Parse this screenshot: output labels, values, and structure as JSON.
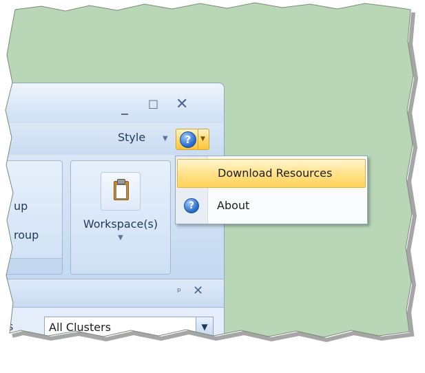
{
  "window_controls": {
    "minimize": "_",
    "maximize": "□",
    "close": "✕"
  },
  "menubar": {
    "style_label": "Style",
    "style_arrow": "▼",
    "help_glyph": "?",
    "help_arrow": "▼"
  },
  "ribbon": {
    "left_group": {
      "line1": "up",
      "line2": "roup"
    },
    "workspace_group": {
      "label": "Workspace(s)",
      "arrow": "▼",
      "icon": "clipboard-icon"
    }
  },
  "panel": {
    "pin_glyph": "ᵖ",
    "close_glyph": "✕",
    "filter_label": "s",
    "cluster_select": {
      "value": "All Clusters",
      "arrow": "▼"
    }
  },
  "help_menu": {
    "items": [
      {
        "label": "Download Resources",
        "icon": ""
      },
      {
        "label": "About",
        "icon": "help-circle-icon",
        "glyph": "?"
      }
    ]
  },
  "colors": {
    "background": "#b9d7b7",
    "window": "#cfdff3",
    "highlight": "#ffd866",
    "text": "#1e395b"
  }
}
